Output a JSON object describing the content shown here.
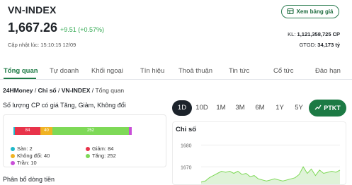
{
  "header": {
    "title": "VN-INDEX",
    "price": "1,667.26",
    "change": "+9.51 (+0.57%)",
    "updated": "Cập nhật lúc: 15:10:15 12/09",
    "view_table_label": "Xem bảng giá",
    "volume_label": "KL:",
    "volume_value": "1,121,358,725 CP",
    "value_label": "GTGD:",
    "value_value": "34,173 tỷ"
  },
  "tabs": [
    {
      "label": "Tổng quan",
      "active": true
    },
    {
      "label": "Tự doanh"
    },
    {
      "label": "Khối ngoại"
    },
    {
      "label": "Tín hiệu"
    },
    {
      "label": "Thoả thuận"
    },
    {
      "label": "Tin tức"
    },
    {
      "label": "Cổ tức"
    },
    {
      "label": "Đảo hạn"
    }
  ],
  "breadcrumb": {
    "items": [
      "24HMoney",
      "Chỉ số",
      "VN-INDEX"
    ],
    "current": "Tổng quan",
    "separator": "/"
  },
  "breadth": {
    "title": "Số lượng CP có giá Tăng, Giảm, Không đổi",
    "segments": [
      {
        "key": "san",
        "label": "Sàn",
        "value": 2,
        "color": "#1fb8c9"
      },
      {
        "key": "giam",
        "label": "Giảm",
        "value": 84,
        "color": "#e8334a"
      },
      {
        "key": "khongdoi",
        "label": "Không đổi",
        "value": 40,
        "color": "#f0b323"
      },
      {
        "key": "tang",
        "label": "Tăng",
        "value": 252,
        "color": "#7ed957"
      },
      {
        "key": "tran",
        "label": "Trần",
        "value": 10,
        "color": "#c94fd8"
      }
    ],
    "legend_text": {
      "san": "Sàn: 2",
      "giam": "Giảm: 84",
      "khongdoi": "Không đổi: 40",
      "tang": "Tăng: 252",
      "tran": "Trần: 10"
    }
  },
  "ranges": {
    "options": [
      "1D",
      "10D",
      "1M",
      "3M",
      "6M",
      "1Y",
      "5Y"
    ],
    "selected": "1D",
    "ptkt_label": "PTKT"
  },
  "chart": {
    "title": "Chỉ số"
  },
  "chart_data": {
    "type": "line",
    "title": "Chỉ số",
    "ylim": [
      1662,
      1684
    ],
    "yticks": [
      "1680",
      "1670"
    ],
    "x": [
      0,
      1,
      2,
      3,
      4,
      5,
      6,
      7,
      8,
      9,
      10,
      11,
      12,
      13,
      14,
      15,
      16,
      17,
      18,
      19,
      20,
      21,
      22,
      23,
      24,
      25,
      26,
      27,
      28,
      29,
      30,
      31,
      32,
      33,
      34
    ],
    "values": [
      1663,
      1663.5,
      1665,
      1666,
      1667,
      1668,
      1667.5,
      1668,
      1667,
      1668,
      1666.5,
      1667,
      1665.5,
      1666,
      1664.5,
      1664,
      1663.5,
      1664,
      1664.5,
      1664,
      1663.5,
      1664,
      1664.5,
      1665,
      1666.5,
      1670,
      1667,
      1669,
      1666,
      1668.5,
      1667,
      1667.5,
      1668,
      1667.5,
      1668.5
    ],
    "fill_color": "#dff3d8",
    "line_color": "#7ed957"
  },
  "flows": {
    "title": "Phân bổ dòng tiền"
  }
}
